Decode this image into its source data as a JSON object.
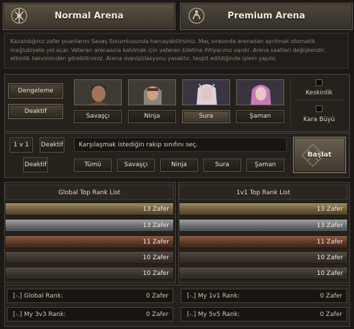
{
  "tabs": [
    {
      "label": "Normal Arena",
      "active": true
    },
    {
      "label": "Premium Arena",
      "active": false
    }
  ],
  "description": "Kazandığınız zafer puanlarını Savaş Sorumlusunda harcayabilirsiniz. Maç sırasında arenadan ayrılmak otomatik mağlubiyete yol açar. Veteran arenasına katılmak için veteran biletine ihtiyacınız vardır. Arena saatleri değişkendir, etkinlik takviminden görebilirsiniz. Arena manipülasyonu yasaktır, tespit edildiğinde işlem yapılır.",
  "left_buttons": {
    "balance": "Dengeleme",
    "inactive": "Deaktif"
  },
  "classes": [
    {
      "label": "Savaşçı",
      "selected": false
    },
    {
      "label": "Ninja",
      "selected": false
    },
    {
      "label": "Sura",
      "selected": true
    },
    {
      "label": "Şaman",
      "selected": false
    }
  ],
  "options": {
    "sharpness": "Keskinlik",
    "black_magic": "Kara Büyü"
  },
  "mode_buttons": {
    "one_v_one": "1 v 1",
    "inactive_a": "Deaktif",
    "inactive_b": "Deaktif"
  },
  "opponent_prompt": "Karşılaşmak istediğin rakip sınıfını seç.",
  "opponent_classes": [
    "Tümü",
    "Savaşçı",
    "Ninja",
    "Sura",
    "Şaman"
  ],
  "start_label": "Başlat",
  "global_list": {
    "title": "Global Top Rank List",
    "rows": [
      "13 Zafer",
      "13 Zafer",
      "11 Zafer",
      "10 Zafer",
      "10 Zafer"
    ]
  },
  "onevone_list": {
    "title": "1v1 Top Rank List",
    "rows": [
      "13 Zafer",
      "13 Zafer",
      "11 Zafer",
      "10 Zafer",
      "10 Zafer"
    ]
  },
  "ranks": [
    {
      "label": "[-.] Global Rank:",
      "value": "0 Zafer"
    },
    {
      "label": "[-.] My 1v1 Rank:",
      "value": "0 Zafer"
    },
    {
      "label": "[-.] My 3v3 Rank:",
      "value": "0 Zafer"
    },
    {
      "label": "[-.] My 5v5 Rank:",
      "value": "0 Zafer"
    }
  ],
  "colors": {
    "gold": "#8a7650",
    "silver": "#8a8b8d",
    "bronze": "#774a34",
    "plain": "#463f35"
  }
}
